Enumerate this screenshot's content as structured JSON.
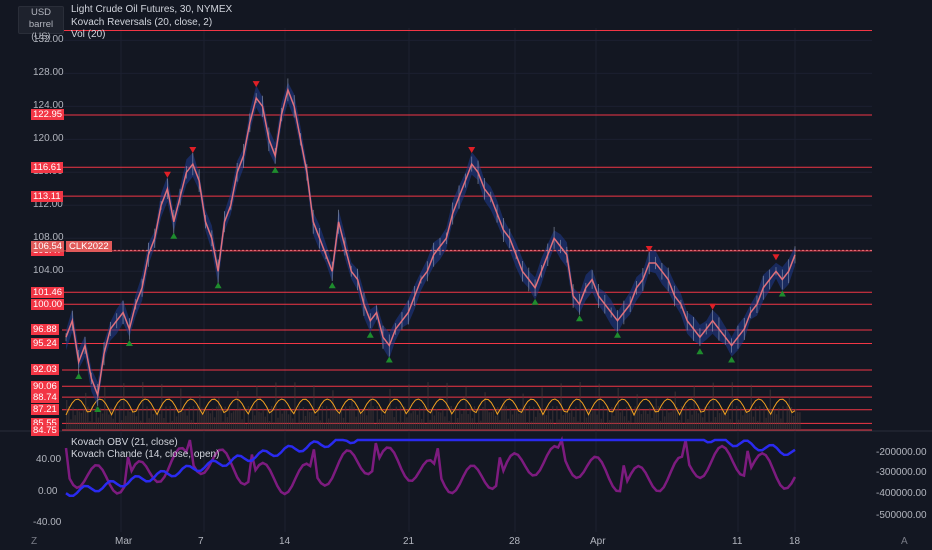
{
  "header": {
    "symbol_title": "Light Crude Oil Futures, 30, NYMEX",
    "indicators": [
      "Kovach Reversals (20, close, 2)",
      "Vol (20)"
    ]
  },
  "unit_selector": {
    "currency": "USD",
    "unit": "barrel (US)"
  },
  "price_axis": {
    "ticks": [
      "132.00",
      "128.00",
      "124.00",
      "120.00",
      "116.00",
      "112.00",
      "108.00",
      "104.00"
    ],
    "level_labels": [
      "122.95",
      "116.61",
      "113.11",
      "106.47",
      "101.46",
      "100.00",
      "96.88",
      "95.24",
      "92.03",
      "90.06",
      "88.74",
      "87.21",
      "85.55",
      "84.75"
    ],
    "current_price": "106.54",
    "symbol_tag": "CLK2022"
  },
  "lower_pane": {
    "indicators": [
      "Kovach OBV (21, close)",
      "Kovach Chande (14, close, open)"
    ],
    "left_ticks": [
      "40.00",
      "0.00",
      "-40.00"
    ],
    "right_ticks": [
      "-200000.00",
      "-300000.00",
      "-400000.00",
      "-500000.00"
    ]
  },
  "time_axis": {
    "ticks": [
      "Mar",
      "7",
      "14",
      "21",
      "28",
      "Apr",
      "11",
      "18"
    ]
  },
  "footer": {
    "left_button": "Z",
    "right_button": "A"
  },
  "colors": {
    "background": "#131722",
    "level_line": "#f23645",
    "price_line": "#e0707a",
    "band": "#1f3a8f",
    "obv": "#2a2af0",
    "chande": "#8a1c8a",
    "reversal_up": "#1e8c2d",
    "reversal_down": "#e01f26"
  },
  "chart_data": {
    "type": "line",
    "title": "Light Crude Oil Futures, 30, NYMEX",
    "xlabel": "",
    "ylabel": "",
    "x_ticks": [
      "Mar",
      "7",
      "14",
      "21",
      "28",
      "Apr",
      "11",
      "18"
    ],
    "ylim": [
      84.75,
      133.5
    ],
    "horizontal_levels": [
      133.2,
      122.95,
      116.61,
      113.11,
      106.47,
      101.46,
      100.0,
      96.88,
      95.24,
      92.03,
      90.06,
      88.74,
      87.21,
      85.55,
      84.75
    ],
    "series": [
      {
        "values": [
          96,
          98,
          93,
          95,
          91,
          89,
          94,
          97,
          98,
          99,
          97,
          100,
          102,
          106,
          108,
          112,
          114,
          110,
          113,
          116,
          117,
          115,
          110,
          108,
          104,
          110,
          112,
          116,
          118,
          122,
          125,
          124,
          120,
          118,
          123,
          126,
          124,
          120,
          116,
          110,
          108,
          106,
          104,
          110,
          107,
          104,
          103,
          100,
          98,
          99,
          96,
          95,
          97,
          98,
          99,
          101,
          103,
          104,
          106,
          107,
          108,
          111,
          113,
          115,
          117,
          116,
          114,
          113,
          111,
          109,
          108,
          106,
          104,
          103,
          102,
          104,
          106,
          108,
          107,
          106,
          101,
          100,
          102,
          103,
          101,
          100,
          99,
          98,
          99,
          100,
          102,
          103,
          105,
          105,
          104,
          103,
          101,
          100,
          98,
          97,
          96,
          97,
          98,
          97,
          96,
          95,
          96,
          97,
          99,
          100,
          102,
          103,
          104,
          103,
          104,
          106
        ]
      }
    ]
  }
}
